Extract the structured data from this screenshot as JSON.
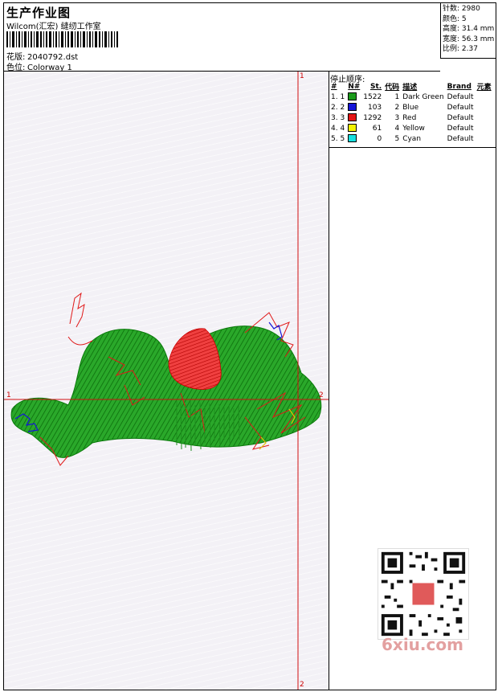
{
  "header": {
    "title": "生产作业图",
    "company": "Wilcom(汇宏) 缝纫工作室",
    "design_label": "花版:",
    "design_value": "2040792.dst",
    "colorway_label": "色位:",
    "colorway_value": "Colorway 1"
  },
  "stats": {
    "stitches": "针数: 2980",
    "colors": "颜色: 5",
    "height": "高度: 31.4 mm",
    "width": "宽度: 56.3 mm",
    "scale": "比例: 2.37"
  },
  "canvas": {
    "marker_top": "1",
    "marker_left": "1",
    "marker_right": "2",
    "marker_bottom": "2"
  },
  "stop_sequence": {
    "title": "停止顺序:",
    "columns": [
      "#",
      "N#",
      "St.",
      "代码",
      "描述",
      "Brand",
      "元素"
    ],
    "rows": [
      {
        "idx": "1. 1",
        "color": "#1a9a1a",
        "st": "1522",
        "code": "1",
        "desc": "Dark Green",
        "brand": "Default"
      },
      {
        "idx": "2. 2",
        "color": "#1515d8",
        "st": "103",
        "code": "2",
        "desc": "Blue",
        "brand": "Default"
      },
      {
        "idx": "3. 3",
        "color": "#e41515",
        "st": "1292",
        "code": "3",
        "desc": "Red",
        "brand": "Default"
      },
      {
        "idx": "4. 4",
        "color": "#f2f200",
        "st": "61",
        "code": "4",
        "desc": "Yellow",
        "brand": "Default"
      },
      {
        "idx": "5. 5",
        "color": "#17e0e0",
        "st": "0",
        "code": "5",
        "desc": "Cyan",
        "brand": "Default"
      }
    ]
  },
  "watermark": "6xiu.com"
}
